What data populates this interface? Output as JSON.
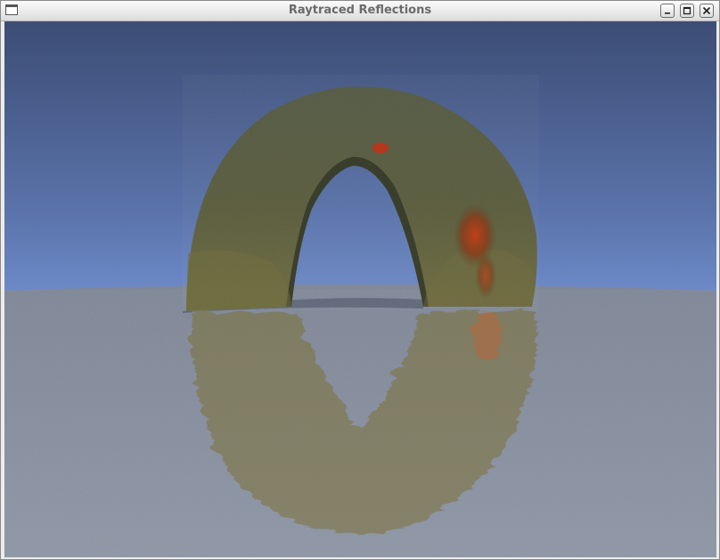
{
  "window": {
    "title": "Raytraced Reflections",
    "controls": {
      "minimize_icon": "minimize-icon",
      "maximize_icon": "maximize-icon",
      "close_icon": "close-icon"
    }
  },
  "scene": {
    "sky_top_color": "#3c4d75",
    "sky_horizon_color": "#6d8ac8",
    "floor_color": "#8a93a3",
    "arch_color": "#555a3e",
    "highlight_color": "#b5371c"
  }
}
